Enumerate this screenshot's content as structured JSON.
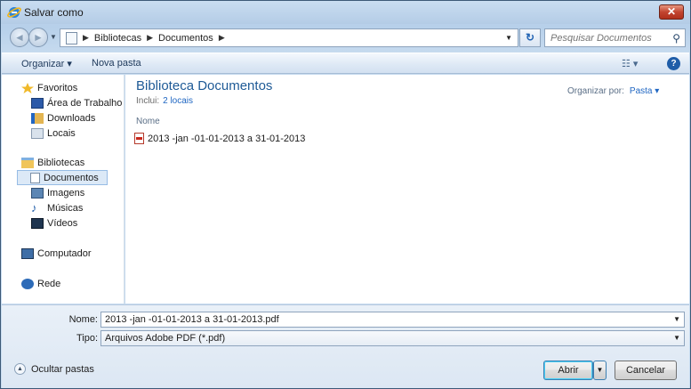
{
  "window": {
    "title": "Salvar como",
    "close_label": "✕"
  },
  "nav": {
    "back_icon": "back-arrow-icon",
    "forward_icon": "forward-arrow-icon",
    "breadcrumbs": [
      "Bibliotecas",
      "Documentos"
    ],
    "search_placeholder": "Pesquisar Documentos"
  },
  "toolbar": {
    "organize_label": "Organizar ▾",
    "new_folder_label": "Nova pasta",
    "views_label": "☷ ▾",
    "help_label": "?"
  },
  "sidebar": {
    "favorites": "Favoritos",
    "desktop": "Área de Trabalho",
    "downloads": "Downloads",
    "places": "Locais",
    "libraries": "Bibliotecas",
    "documents": "Documentos",
    "images": "Imagens",
    "music": "Músicas",
    "videos": "Vídeos",
    "computer": "Computador",
    "network": "Rede"
  },
  "content": {
    "library_title": "Biblioteca Documentos",
    "includes_label": "Inclui:",
    "includes_link": "2 locais",
    "arrange_by_label": "Organizar por:",
    "arrange_by_value": "Pasta ▾",
    "column_name": "Nome",
    "files": [
      "2013 -jan -01-01-2013 a 31-01-2013"
    ]
  },
  "bottom": {
    "name_label": "Nome:",
    "name_value": "2013 -jan -01-01-2013 a 31-01-2013.pdf",
    "type_label": "Tipo:",
    "type_value": "Arquivos Adobe PDF (*.pdf)",
    "hide_folders_label": "Ocultar pastas",
    "open_label": "Abrir",
    "cancel_label": "Cancelar"
  },
  "colors": {
    "accent": "#1e5a96",
    "link": "#1f66c2",
    "close": "#c24530"
  }
}
